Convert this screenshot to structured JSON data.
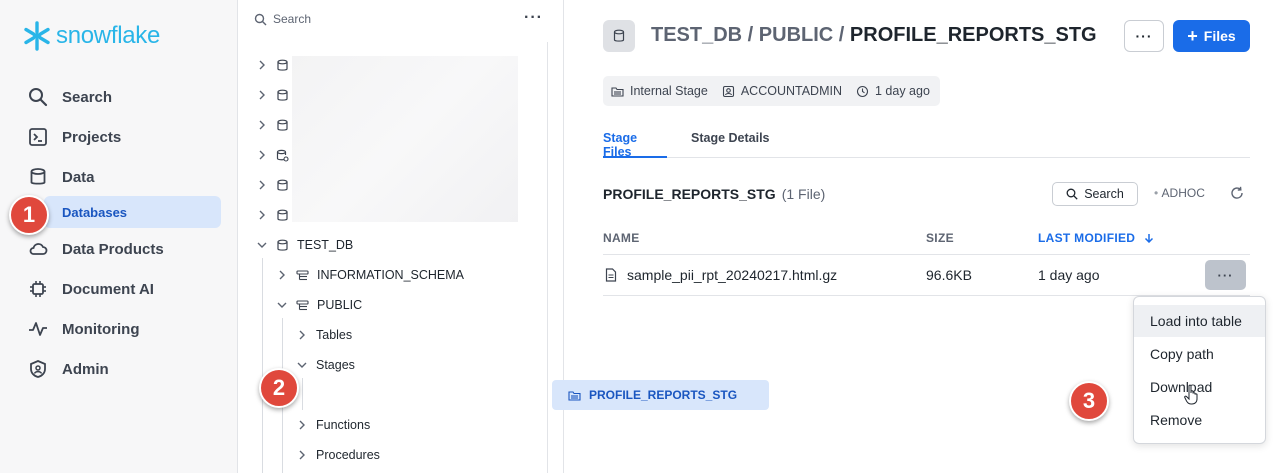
{
  "brand": {
    "name": "snowflake",
    "color": "#29b5e8"
  },
  "nav": {
    "items": [
      {
        "label": "Search",
        "icon": "search-icon"
      },
      {
        "label": "Projects",
        "icon": "projects-icon"
      },
      {
        "label": "Data",
        "icon": "database-icon"
      },
      {
        "label": "Data Products",
        "icon": "cloud-icon"
      },
      {
        "label": "Document AI",
        "icon": "chip-icon"
      },
      {
        "label": "Monitoring",
        "icon": "pulse-icon"
      },
      {
        "label": "Admin",
        "icon": "shield-icon"
      }
    ],
    "sub_selected": "Databases"
  },
  "tree": {
    "search_placeholder": "Search",
    "more": "···",
    "db": "TEST_DB",
    "schemas": [
      "INFORMATION_SCHEMA",
      "PUBLIC"
    ],
    "public_children": [
      "Tables",
      "Stages",
      "Functions",
      "Procedures"
    ],
    "selected_stage": "PROFILE_REPORTS_STG"
  },
  "header": {
    "path_prefix": "TEST_DB / PUBLIC / ",
    "current": "PROFILE_REPORTS_STG",
    "more": "···",
    "files_button": "Files"
  },
  "meta": {
    "type": "Internal Stage",
    "owner": "ACCOUNTADMIN",
    "created": "1 day ago"
  },
  "tabs": [
    "Stage Files",
    "Stage Details"
  ],
  "active_tab": "Stage Files",
  "files_section": {
    "title": "PROFILE_REPORTS_STG",
    "count": "(1 File)",
    "search": "Search",
    "warehouse": "ADHOC",
    "columns": {
      "name": "NAME",
      "size": "SIZE",
      "modified": "LAST MODIFIED"
    },
    "rows": [
      {
        "name": "sample_pii_rpt_20240217.html.gz",
        "size": "96.6KB",
        "modified": "1 day ago"
      }
    ],
    "row_more": "···"
  },
  "context_menu": [
    "Load into table",
    "Copy path",
    "Download",
    "Remove"
  ],
  "badges": [
    "1",
    "2",
    "3"
  ],
  "colors": {
    "accent": "#1a6ce8",
    "selected_bg": "#d8e6fb",
    "badge": "#e0483c"
  }
}
